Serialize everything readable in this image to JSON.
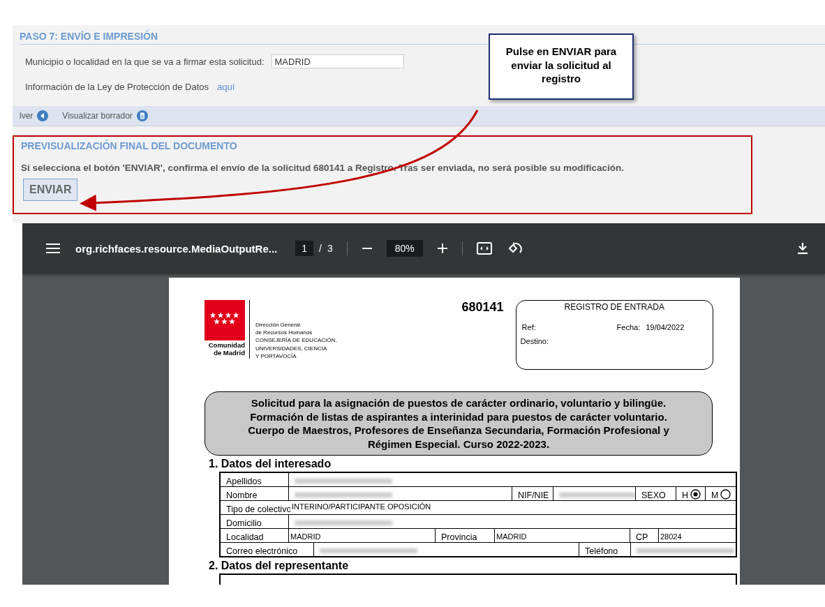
{
  "step": {
    "title": "PASO 7: ENVÍO E IMPRESIÓN",
    "municipality_label": "Municipio o localidad en la que se va a firmar esta solicitud:",
    "municipality_value": "MADRID",
    "data_protection_label": "Información de la Ley de Protección de Datos",
    "data_protection_link": "aquí"
  },
  "actions": [
    {
      "label": "lver",
      "kind": "back"
    },
    {
      "label": "Visualizar borrador",
      "kind": "document"
    }
  ],
  "preview": {
    "title": "PREVISUALIZACIÓN FINAL DEL DOCUMENTO",
    "message": "Si selecciona el botón 'ENVIAR', confirma el envío de la solicitud 680141 a Registro. Tras ser enviada, no será posible su modificación.",
    "button": "ENVIAR"
  },
  "callout": {
    "text": "Pulse en ENVIAR para enviar la solicitud al registro"
  },
  "pdf_viewer": {
    "file_name": "org.richfaces.resource.MediaOutputRe...",
    "page_current": "1",
    "page_separator": "/",
    "page_total": "3",
    "zoom": "80%"
  },
  "document": {
    "logo_text": [
      "Comunidad",
      "de Madrid"
    ],
    "org_lines": [
      "Dirección General",
      "de Recursos Humanos",
      "CONSEJERÍA DE EDUCACIÓN,",
      "UNIVERSIDADES, CIENCIA",
      "Y PORTAVOCÍA"
    ],
    "request_number": "680141",
    "registry": {
      "title": "REGISTRO DE ENTRADA",
      "ref_label": "Ref:",
      "date_label": "Fecha:",
      "date_value": "19/04/2022",
      "destination_label": "Destino:"
    },
    "title_lines": [
      "Solicitud para la asignación de puestos de carácter ordinario, voluntario y bilingüe.",
      "Formación de listas de aspirantes a interinidad para puestos de carácter voluntario.",
      "Cuerpo de Maestros, Profesores de Enseñanza Secundaria, Formación Profesional y",
      "Régimen Especial. Curso 2022-2023."
    ],
    "section_1": "1. Datos del interesado",
    "rows": [
      [
        {
          "kind": "label",
          "text": "Apellidos"
        },
        {
          "kind": "blurred"
        }
      ],
      [
        {
          "kind": "label",
          "text": "Nombre"
        },
        {
          "kind": "blurred"
        },
        {
          "kind": "label",
          "text": "NIF/NIE"
        },
        {
          "kind": "blurred"
        },
        {
          "kind": "label",
          "text": "SEXO"
        },
        {
          "kind": "radio",
          "text": "H",
          "selected": true
        },
        {
          "kind": "radio",
          "text": "M",
          "selected": false
        }
      ],
      [
        {
          "kind": "label",
          "text": "Tipo de colectivo"
        },
        {
          "kind": "value",
          "text": "INTERINO/PARTICIPANTE OPOSICIÓN"
        }
      ],
      [
        {
          "kind": "label",
          "text": "Domicilio"
        },
        {
          "kind": "blurred"
        }
      ],
      [
        {
          "kind": "label",
          "text": "Localidad"
        },
        {
          "kind": "value",
          "text": "MADRID"
        },
        {
          "kind": "label",
          "text": "Provincia"
        },
        {
          "kind": "value",
          "text": "MADRID"
        },
        {
          "kind": "label",
          "text": "CP"
        },
        {
          "kind": "value",
          "text": "28024"
        }
      ],
      [
        {
          "kind": "label",
          "text": "Correo electrónico"
        },
        {
          "kind": "blurred"
        },
        {
          "kind": "label",
          "text": "Teléfono"
        },
        {
          "kind": "blurred"
        }
      ]
    ],
    "section_2": "2. Datos del representante"
  }
}
